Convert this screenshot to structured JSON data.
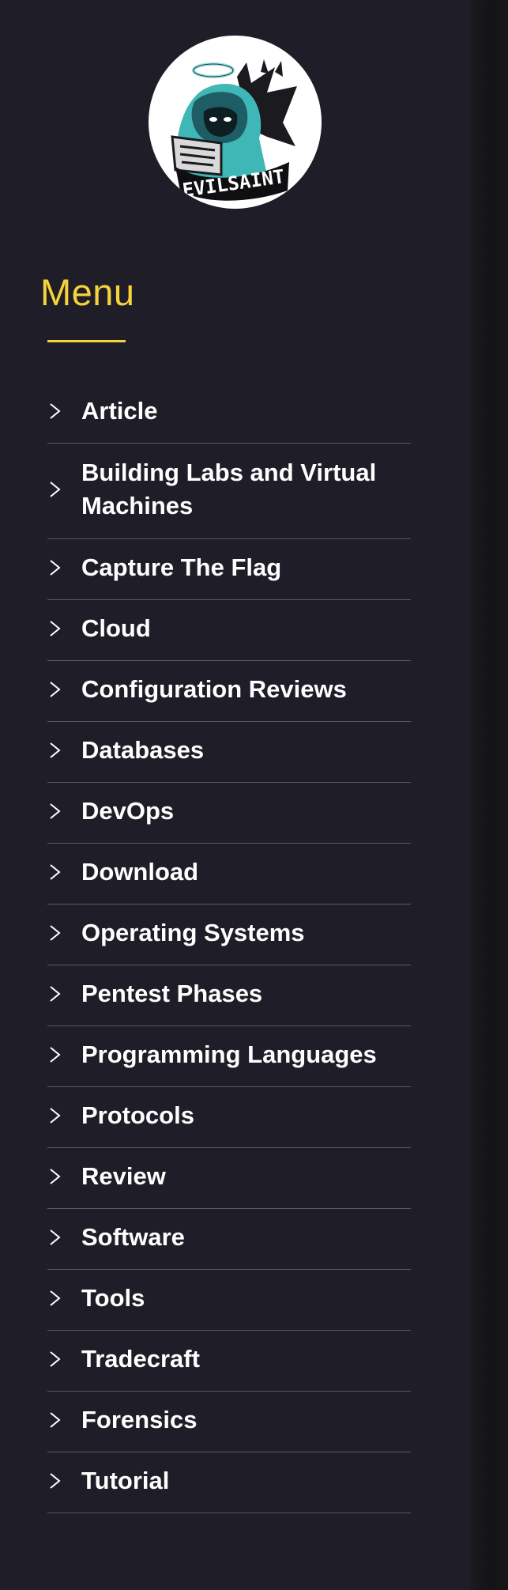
{
  "logo": {
    "text": "EVILSAINT",
    "icon": "evilsaint-logo-icon"
  },
  "menu": {
    "heading": "Menu",
    "accent_color": "#f5d33a",
    "chevron_icon": "chevron-right-icon",
    "items": [
      {
        "label": "Article"
      },
      {
        "label": "Building Labs and Virtual Machines"
      },
      {
        "label": "Capture The Flag"
      },
      {
        "label": "Cloud"
      },
      {
        "label": "Configuration Reviews"
      },
      {
        "label": "Databases"
      },
      {
        "label": "DevOps"
      },
      {
        "label": "Download"
      },
      {
        "label": "Operating Systems"
      },
      {
        "label": "Pentest Phases"
      },
      {
        "label": "Programming Languages"
      },
      {
        "label": "Protocols"
      },
      {
        "label": "Review"
      },
      {
        "label": "Software"
      },
      {
        "label": "Tools"
      },
      {
        "label": "Tradecraft"
      },
      {
        "label": "Forensics"
      },
      {
        "label": "Tutorial"
      }
    ]
  }
}
